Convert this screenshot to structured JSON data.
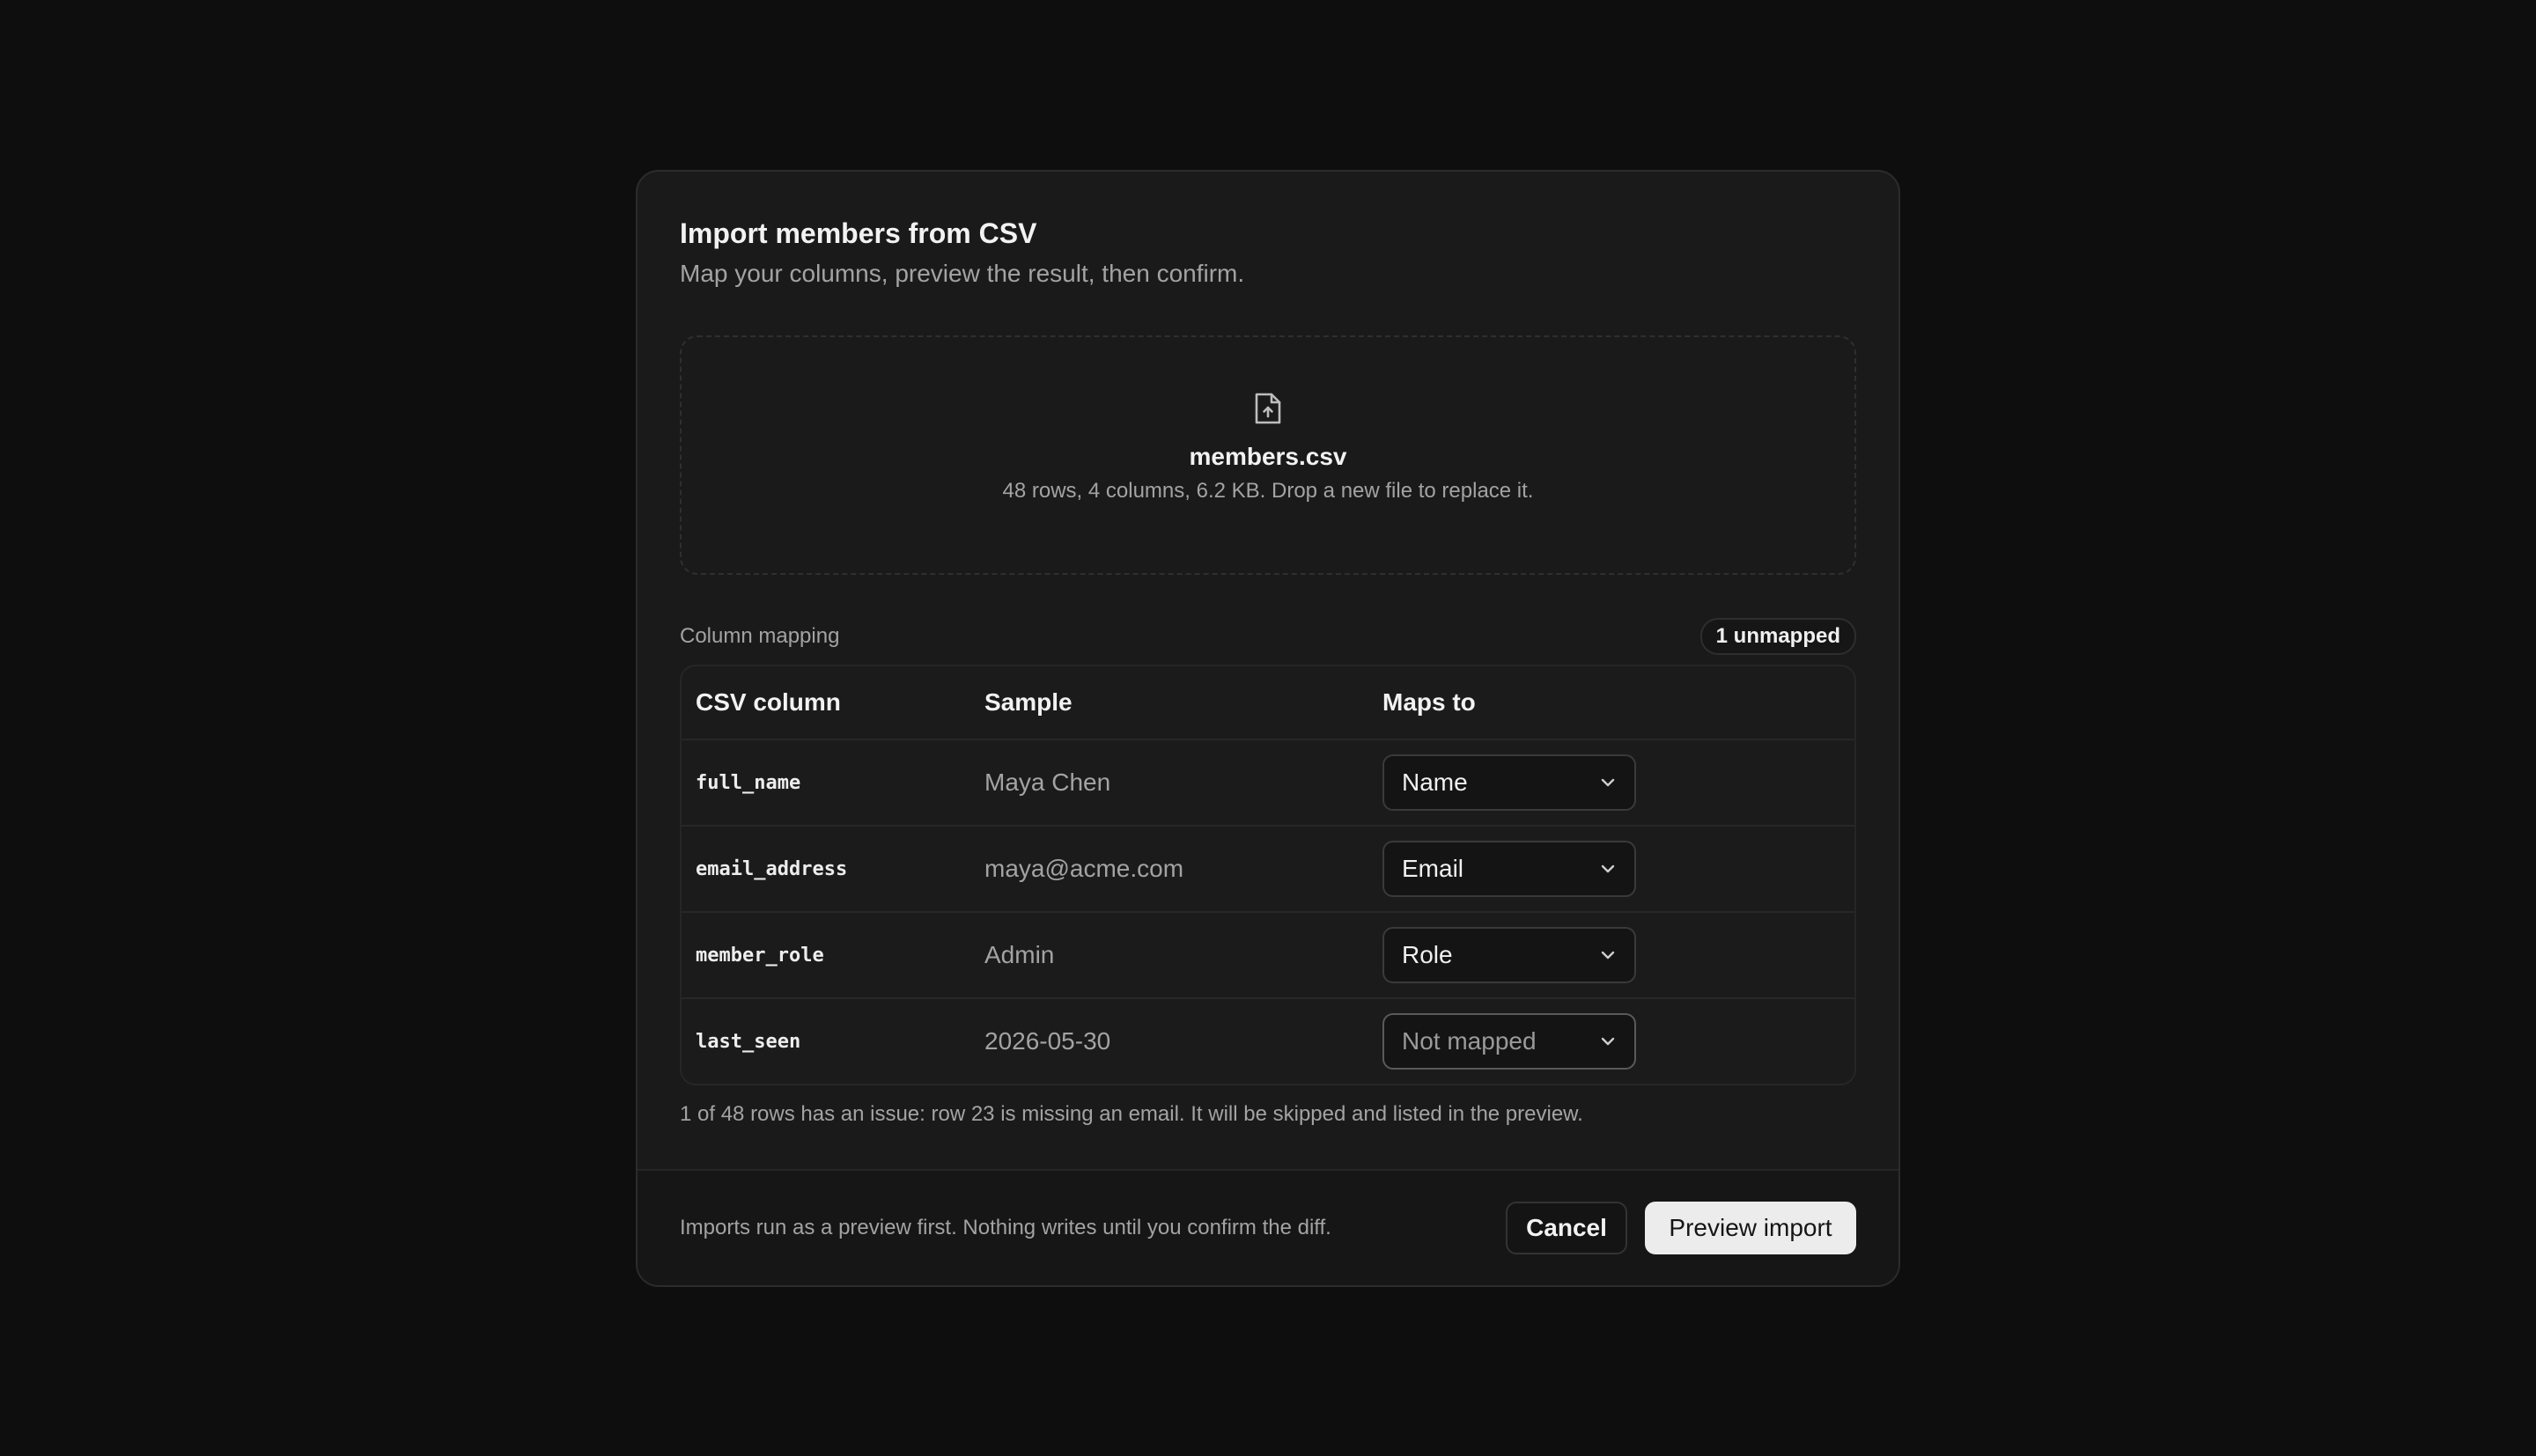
{
  "dialog": {
    "title": "Import members from CSV",
    "subtitle": "Map your columns, preview the result, then confirm."
  },
  "dropzone": {
    "icon": "file-upload-icon",
    "file_name": "members.csv",
    "file_meta": "48 rows, 4 columns, 6.2 KB. Drop a new file to replace it."
  },
  "mapping": {
    "label": "Column mapping",
    "badge": "1 unmapped",
    "headers": [
      "CSV column",
      "Sample",
      "Maps to"
    ],
    "rows": [
      {
        "column": "full_name",
        "sample": "Maya Chen",
        "maps_to": "Name",
        "mapped": true
      },
      {
        "column": "email_address",
        "sample": "maya@acme.com",
        "maps_to": "Email",
        "mapped": true
      },
      {
        "column": "member_role",
        "sample": "Admin",
        "maps_to": "Role",
        "mapped": true
      },
      {
        "column": "last_seen",
        "sample": "2026-05-30",
        "maps_to": "Not mapped",
        "mapped": false
      }
    ],
    "issue": "1 of 48 rows has an issue: row 23 is missing an email. It will be skipped and listed in the preview."
  },
  "footer": {
    "note": "Imports run as a preview first. Nothing writes until you confirm the diff.",
    "cancel_label": "Cancel",
    "primary_label": "Preview import"
  }
}
